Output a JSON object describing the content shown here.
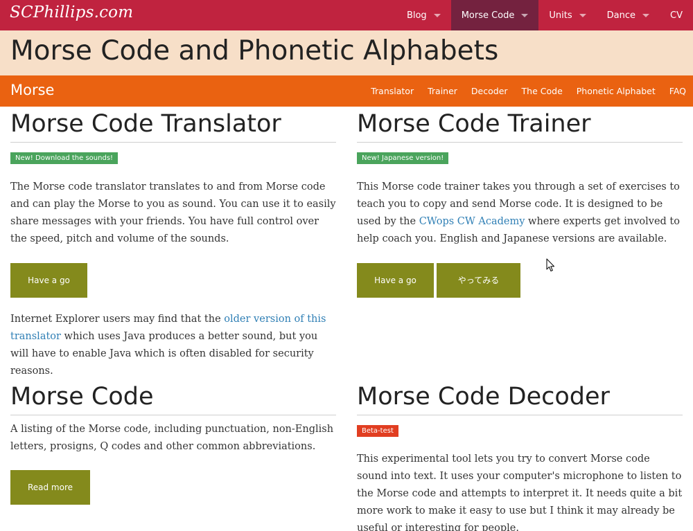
{
  "site": {
    "logo": "SCPhillips.com"
  },
  "topnav": {
    "items": [
      {
        "label": "Blog",
        "has_caret": true
      },
      {
        "label": "Morse Code",
        "has_caret": true,
        "active": true
      },
      {
        "label": "Units",
        "has_caret": true
      },
      {
        "label": "Dance",
        "has_caret": true
      },
      {
        "label": "CV",
        "has_caret": false
      }
    ]
  },
  "page": {
    "title": "Morse Code and Phonetic Alphabets"
  },
  "subnav": {
    "brand": "Morse",
    "links": [
      "Translator",
      "Trainer",
      "Decoder",
      "The Code",
      "Phonetic Alphabet",
      "FAQ"
    ]
  },
  "translator": {
    "heading": "Morse Code Translator",
    "badge": "New! Download the sounds!",
    "description": "The Morse code translator translates to and from Morse code and can play the Morse to you as sound. You can use it to easily share messages with your friends. You have full control over the speed, pitch and volume of the sounds.",
    "button": "Have a go",
    "note_before": "Internet Explorer users may find that the ",
    "note_link": "older version of this translator",
    "note_after": " which uses Java produces a better sound, but you will have to enable Java which is often disabled for security reasons."
  },
  "trainer": {
    "heading": "Morse Code Trainer",
    "badge": "New! Japanese version!",
    "desc_before": "This Morse code trainer takes you through a set of exercises to teach you to copy and send Morse code. It is designed to be used by the ",
    "desc_link": "CWops CW Academy",
    "desc_after": " where experts get involved to help coach you. English and Japanese versions are available.",
    "button_en": "Have a go",
    "button_jp": "やってみる"
  },
  "code": {
    "heading": "Morse Code",
    "description": "A listing of the Morse code, including punctuation, non-English letters, prosigns, Q codes and other common abbreviations.",
    "button": "Read more"
  },
  "decoder": {
    "heading": "Morse Code Decoder",
    "badge": "Beta-test",
    "description": "This experimental tool lets you try to convert Morse code sound into text. It uses your computer's microphone to listen to the Morse code and attempts to interpret it. It needs quite a bit more work to make it easy to use but I think it may already be useful or interesting for people."
  },
  "colors": {
    "top_bar": "#c0233f",
    "top_bar_active": "#74223f",
    "title_band": "#f7dfc8",
    "sub_bar": "#ea6211",
    "button": "#848a1c",
    "badge_green": "#4aa45c",
    "badge_red": "#e13e21",
    "link": "#2f7fb5"
  },
  "icons": {
    "caret": "chevron-down-icon",
    "cursor": "mouse-cursor-icon"
  }
}
